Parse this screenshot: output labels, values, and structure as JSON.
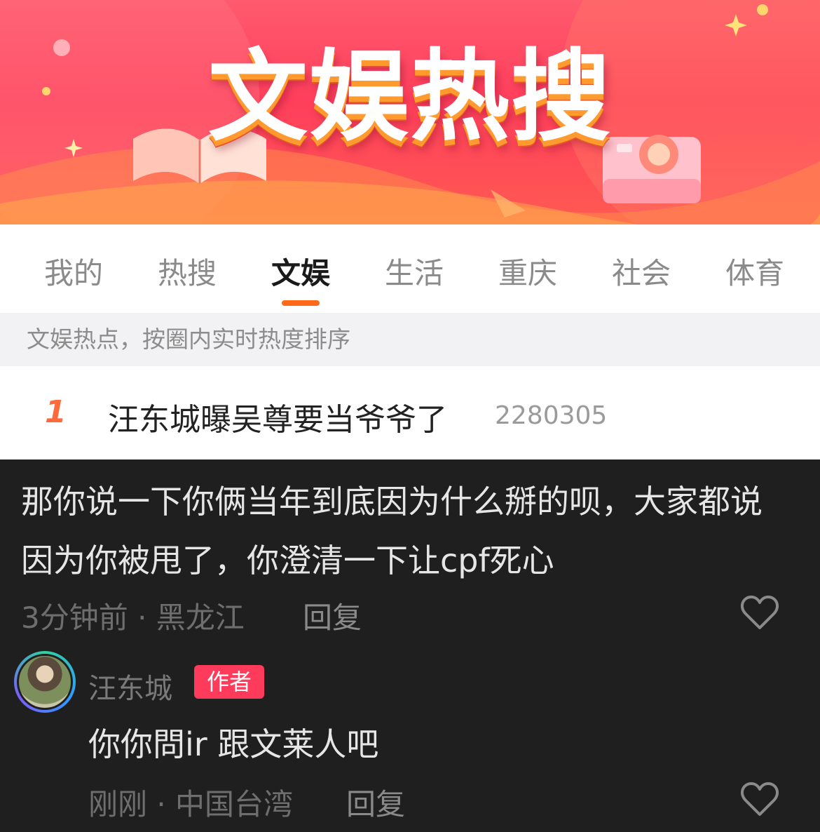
{
  "banner": {
    "title": "文娱热搜"
  },
  "tabs": [
    {
      "label": "我的"
    },
    {
      "label": "热搜"
    },
    {
      "label": "文娱"
    },
    {
      "label": "生活"
    },
    {
      "label": "重庆"
    },
    {
      "label": "社会"
    },
    {
      "label": "体育"
    }
  ],
  "active_tab": "文娱",
  "subheader": "文娱热点，按圈内实时热度排序",
  "hot_item": {
    "rank": "1",
    "title": "汪东城曝吴尊要当爷爷了",
    "count": "2280305"
  },
  "comment": {
    "text": "那你说一下你俩当年到底因为什么掰的呗，大家都说因为你被甩了，你澄清一下让cpf死心",
    "meta": "3分钟前 · 黑龙江",
    "reply_label": "回复"
  },
  "reply": {
    "author": "汪东城",
    "badge": "作者",
    "text": "你你問ir 跟文莱人吧",
    "meta": "刚刚 · 中国台湾",
    "reply_label": "回复"
  },
  "colors": {
    "accent": "#ff6a1a",
    "rank": "#ff6a3d",
    "badge": "#ff3b5c",
    "dark_bg": "#1f1f1f"
  },
  "icons": [
    "heart-outline-icon",
    "book-icon",
    "camera-icon",
    "sparkle-icon"
  ]
}
